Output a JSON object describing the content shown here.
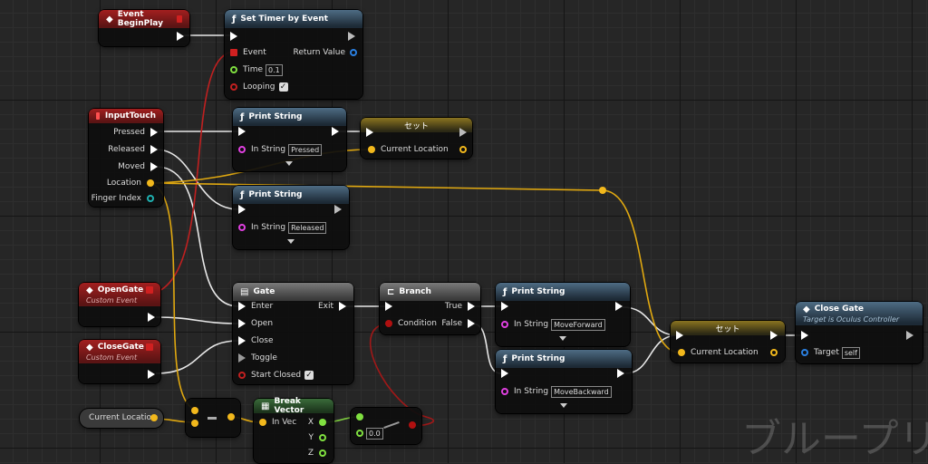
{
  "nodes": {
    "event_begin_play": {
      "title": "Event BeginPlay"
    },
    "set_timer": {
      "title": "Set Timer by Event",
      "event_label": "Event",
      "return_label": "Return Value",
      "time_label": "Time",
      "time_value": "0.1",
      "looping_label": "Looping"
    },
    "input_touch": {
      "title": "InputTouch",
      "pressed": "Pressed",
      "released": "Released",
      "moved": "Moved",
      "location": "Location",
      "finger_index": "Finger Index"
    },
    "print_pressed": {
      "title": "Print String",
      "in_string_label": "In String",
      "in_string_value": "Pressed"
    },
    "print_released": {
      "title": "Print String",
      "in_string_label": "In String",
      "in_string_value": "Released"
    },
    "set_top": {
      "title": "セット",
      "var_label": "Current Location"
    },
    "open_gate": {
      "title": "OpenGate",
      "subtitle": "Custom Event"
    },
    "close_gate_event": {
      "title": "CloseGate",
      "subtitle": "Custom Event"
    },
    "gate": {
      "title": "Gate",
      "enter": "Enter",
      "exit": "Exit",
      "open": "Open",
      "close": "Close",
      "toggle": "Toggle",
      "start_closed": "Start Closed"
    },
    "branch": {
      "title": "Branch",
      "condition": "Condition",
      "true": "True",
      "false": "False"
    },
    "print_forward": {
      "title": "Print String",
      "in_string_label": "In String",
      "in_string_value": "MoveForward"
    },
    "print_backward": {
      "title": "Print String",
      "in_string_label": "In String",
      "in_string_value": "MoveBackward"
    },
    "set_bottom": {
      "title": "セット",
      "var_label": "Current Location"
    },
    "close_gate_call": {
      "title": "Close Gate",
      "subtitle": "Target is Oculus Controller",
      "target_label": "Target",
      "target_value": "self"
    },
    "current_location_get": {
      "title": "Current Location"
    },
    "break_vector": {
      "title": "Break Vector",
      "in_vec": "In Vec",
      "x": "X",
      "y": "Y",
      "z": "Z"
    },
    "compare": {
      "value": "0.0"
    }
  },
  "watermark": "ブループリ",
  "colors": {
    "exec": "#ffffff",
    "vector": "#f2b81c",
    "float": "#80e040",
    "bool": "#b01010",
    "string": "#e040e0",
    "object": "#2a7fe0"
  }
}
